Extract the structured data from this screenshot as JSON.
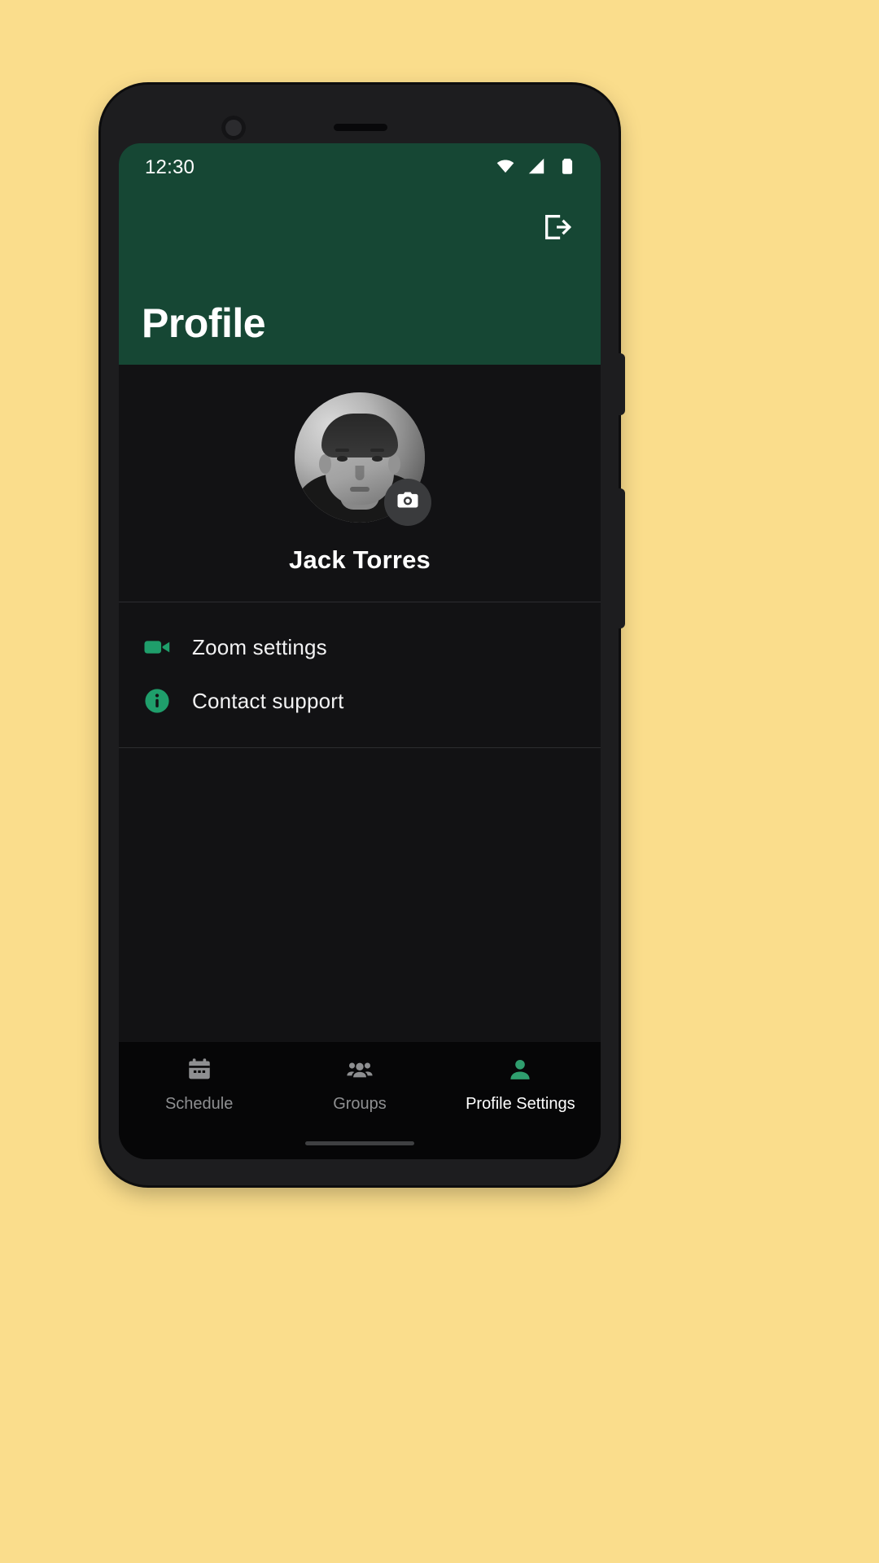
{
  "status_bar": {
    "time": "12:30",
    "icons": [
      "wifi-icon",
      "cellular-signal-icon",
      "battery-icon"
    ]
  },
  "header": {
    "title": "Profile",
    "logout_icon": "logout-icon",
    "background_color": "#164734"
  },
  "profile": {
    "name": "Jack Torres",
    "avatar_alt": "user-avatar-photo",
    "change_photo_icon": "camera-icon"
  },
  "menu": {
    "items": [
      {
        "label": "Zoom settings",
        "icon": "video-camera-icon",
        "icon_color": "#1f9e6b"
      },
      {
        "label": "Contact support",
        "icon": "info-circle-icon",
        "icon_color": "#1f9e6b"
      }
    ]
  },
  "bottom_nav": {
    "items": [
      {
        "label": "Schedule",
        "icon": "calendar-icon",
        "active": false
      },
      {
        "label": "Groups",
        "icon": "people-icon",
        "active": false
      },
      {
        "label": "Profile Settings",
        "icon": "person-icon",
        "active": true
      }
    ],
    "active_color": "#2f9e6e",
    "inactive_color": "#8e8f91"
  },
  "theme": {
    "page_background": "#fadd8c",
    "screen_background": "#121214",
    "accent_green": "#1f9e6b"
  }
}
